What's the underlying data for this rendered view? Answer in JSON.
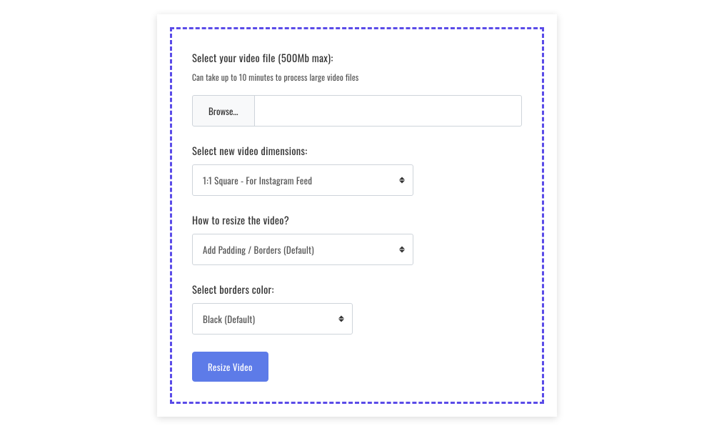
{
  "form": {
    "file_section": {
      "label": "Select your video file (500Mb max):",
      "sublabel": "Can take up to 10 minutes to process large video files",
      "browse_label": "Browse…",
      "file_value": ""
    },
    "dimensions_section": {
      "label": "Select new video dimensions:",
      "selected": "1:1 Square - For Instagram Feed"
    },
    "resize_section": {
      "label": "How to resize the video?",
      "selected": "Add Padding / Borders (Default)"
    },
    "borders_section": {
      "label": "Select borders color:",
      "selected": "Black (Default)"
    },
    "submit_label": "Resize Video"
  }
}
